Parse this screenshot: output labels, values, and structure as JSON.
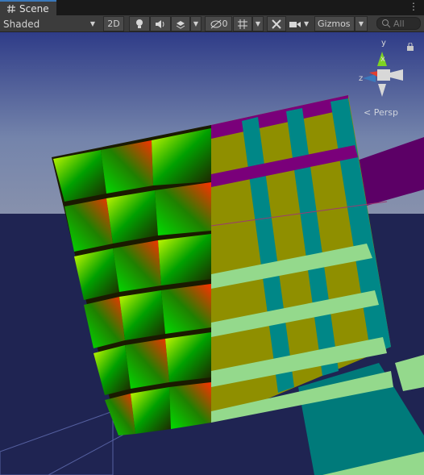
{
  "tab": {
    "title": "Scene",
    "more_icon": "kebab-menu-icon"
  },
  "toolbar": {
    "shading_mode": "Shaded",
    "mode_2d_label": "2D",
    "hidden_count": "0",
    "gizmos_label": "Gizmos",
    "search_placeholder": "All"
  },
  "viewport": {
    "projection_label": "Persp",
    "gizmo_axes": {
      "x": "x",
      "y": "y",
      "z": "z"
    },
    "colors": {
      "sky": "#6e7ea7",
      "ground": "#1f2452",
      "shelf_yellow": "#8f8f00",
      "shelf_teal": "#008787",
      "shelf_purple": "#7a007a",
      "shelf_light_green": "#94d98c",
      "accent_blue": "#3a79bb"
    }
  }
}
